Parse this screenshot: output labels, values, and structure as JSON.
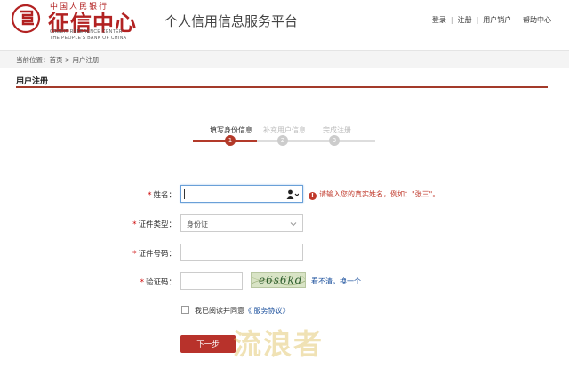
{
  "header": {
    "logo_top": "中国人民银行",
    "logo_main": "征信中心",
    "logo_en_line1": "CREDIT REFERENCE CENTER",
    "logo_en_line2": "THE PEOPLE'S BANK OF CHINA",
    "platform_title": "个人信用信息服务平台",
    "links": [
      "登录",
      "注册",
      "用户销户",
      "帮助中心"
    ]
  },
  "breadcrumb": "当前位置：首页 > 用户注册",
  "section_title": "用户注册",
  "steps": [
    {
      "label": "填写身份信息",
      "number": "1",
      "active": true
    },
    {
      "label": "补充用户信息",
      "number": "2",
      "active": false
    },
    {
      "label": "完成注册",
      "number": "3",
      "active": false
    }
  ],
  "form": {
    "name_label": "姓名：",
    "name_value": "",
    "name_hint": "请输入您的真实姓名，例如：\"张三\"。",
    "id_type_label": "证件类型：",
    "id_type_value": "身份证",
    "id_number_label": "证件号码：",
    "id_number_value": "",
    "captcha_label": "验证码：",
    "captcha_value": "",
    "captcha_text": "e6s6kd",
    "captcha_refresh": "看不清，换一个",
    "agree_text": "我已阅读并同意",
    "agree_link": "《 服务协议》",
    "next_button": "下一步",
    "required_mark": "*"
  },
  "watermark": "流浪者",
  "colors": {
    "brand_red": "#b22222",
    "accent": "#b33a2a",
    "link": "#1a4f9c"
  }
}
